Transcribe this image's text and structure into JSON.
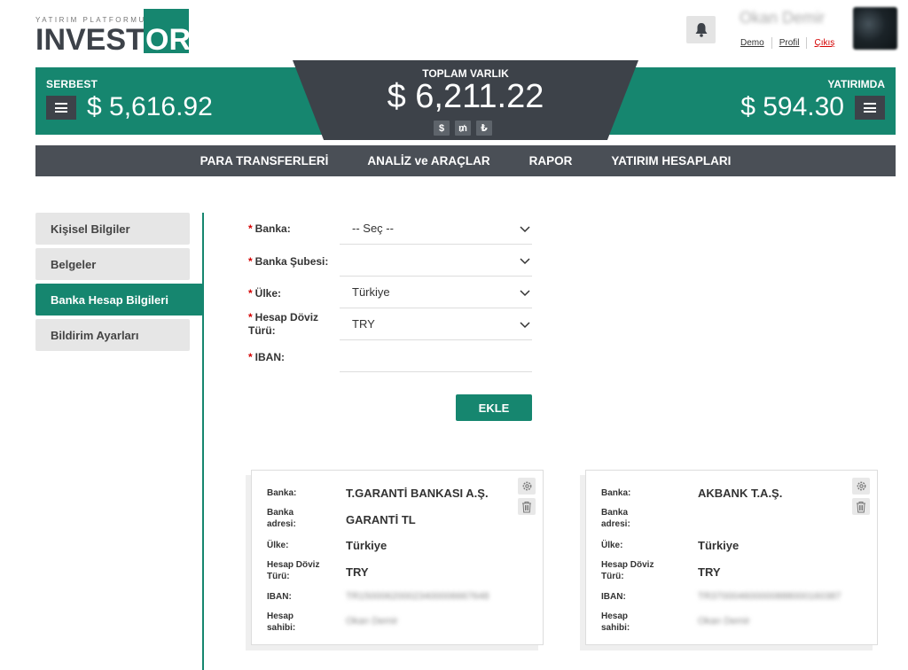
{
  "brand": {
    "tagline": "YATIRIM PLATFORMU",
    "word_left": "INVEST",
    "word_box": "OR",
    "color": "#16866f"
  },
  "user": {
    "name": "Okan Demir",
    "links": {
      "demo": "Demo",
      "profile": "Profil",
      "logout": "Çıkış"
    }
  },
  "balances": {
    "serbest_label": "SERBEST",
    "serbest_amount": "$ 5,616.92",
    "toplam_label": "TOPLAM VARLIK",
    "toplam_amount": "$ 6,211.22",
    "yatirimda_label": "YATIRIMDA",
    "yatirimda_amount": "$ 594.30",
    "currencies": [
      "$",
      "₥",
      "₺"
    ]
  },
  "nav": [
    "PARA TRANSFERLERİ",
    "ANALİZ ve ARAÇLAR",
    "RAPOR",
    "YATIRIM HESAPLARI"
  ],
  "sidebar": [
    {
      "label": "Kişisel Bilgiler",
      "active": false
    },
    {
      "label": "Belgeler",
      "active": false
    },
    {
      "label": "Banka Hesap Bilgileri",
      "active": true
    },
    {
      "label": "Bildirim Ayarları",
      "active": false
    }
  ],
  "form": {
    "fields": [
      {
        "label": "Banka:",
        "value": "-- Seç --",
        "dropdown": true
      },
      {
        "label": "Banka Şubesi:",
        "value": "",
        "dropdown": true
      },
      {
        "label": "Ülke:",
        "value": "Türkiye",
        "dropdown": true
      },
      {
        "label": "Hesap Döviz Türü:",
        "value": "TRY",
        "dropdown": true
      },
      {
        "label": "IBAN:",
        "value": "",
        "dropdown": false
      }
    ],
    "submit": "EKLE"
  },
  "cards": [
    {
      "rows": [
        {
          "key": "Banka:",
          "value": "T.GARANTİ BANKASI A.Ş."
        },
        {
          "key": "Banka adresi:",
          "value": "GARANTİ TL"
        },
        {
          "key": "Ülke:",
          "value": "Türkiye"
        },
        {
          "key": "Hesap Döviz Türü:",
          "value": "TRY"
        },
        {
          "key": "IBAN:",
          "value": "TR150006200023400006667648"
        },
        {
          "key": "Hesap sahibi:",
          "value": "Okan Demir"
        }
      ]
    },
    {
      "rows": [
        {
          "key": "Banka:",
          "value": "AKBANK T.A.Ş."
        },
        {
          "key": "Banka adresi:",
          "value": ""
        },
        {
          "key": "Ülke:",
          "value": "Türkiye"
        },
        {
          "key": "Hesap Döviz Türü:",
          "value": "TRY"
        },
        {
          "key": "IBAN:",
          "value": "TR370004600000888000160387"
        },
        {
          "key": "Hesap sahibi:",
          "value": "Okan Demir"
        }
      ]
    }
  ],
  "icons": {
    "notification": "bell-icon",
    "menu": "hamburger-icon",
    "dropdown": "chevron-down-icon",
    "settings": "gear-icon",
    "delete": "trash-icon"
  }
}
